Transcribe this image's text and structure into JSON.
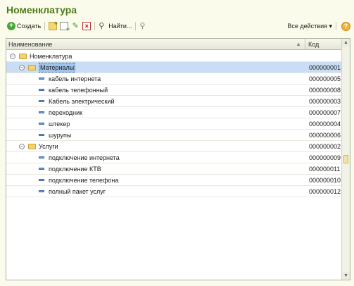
{
  "window": {
    "title": "Номенклатура"
  },
  "toolbar": {
    "create_label": "Создать",
    "find_label": "Найти...",
    "all_actions_label": "Все действия ▾",
    "help_label": "?"
  },
  "grid": {
    "columns": {
      "name": "Наименование",
      "code": "Код"
    },
    "rows": [
      {
        "name": "Номенклатура",
        "code": "",
        "type": "group",
        "level": 0,
        "expanded": true,
        "selected": false
      },
      {
        "name": "Материалы",
        "code": "000000001",
        "type": "group",
        "level": 1,
        "expanded": true,
        "selected": true
      },
      {
        "name": "кабель интернета",
        "code": "000000005",
        "type": "item",
        "level": 2,
        "selected": false
      },
      {
        "name": "кабель телефонный",
        "code": "000000008",
        "type": "item",
        "level": 2,
        "selected": false
      },
      {
        "name": "Кабель электрический",
        "code": "000000003",
        "type": "item",
        "level": 2,
        "selected": false
      },
      {
        "name": "переходник",
        "code": "000000007",
        "type": "item",
        "level": 2,
        "selected": false
      },
      {
        "name": "штекер",
        "code": "000000004",
        "type": "item",
        "level": 2,
        "selected": false
      },
      {
        "name": "шурупы",
        "code": "000000006",
        "type": "item",
        "level": 2,
        "selected": false
      },
      {
        "name": "Услуги",
        "code": "000000002",
        "type": "group",
        "level": 1,
        "expanded": true,
        "selected": false
      },
      {
        "name": "подключение интернета",
        "code": "000000009",
        "type": "item",
        "level": 2,
        "selected": false
      },
      {
        "name": "подключение КТВ",
        "code": "000000011",
        "type": "item",
        "level": 2,
        "selected": false
      },
      {
        "name": "подключение телефона",
        "code": "000000010",
        "type": "item",
        "level": 2,
        "selected": false
      },
      {
        "name": "полный пакет услуг",
        "code": "000000012",
        "type": "item",
        "level": 2,
        "selected": false
      }
    ]
  },
  "icons": {
    "create": "plus-circle-icon",
    "add_group": "folder-add-icon",
    "copy": "copy-icon",
    "edit": "pencil-icon",
    "delete": "delete-mark-icon",
    "find": "magnifier-icon",
    "cancel_find": "cancel-search-icon",
    "help": "help-icon"
  },
  "colors": {
    "title": "#4e7c19",
    "selection": "#c9def4"
  }
}
